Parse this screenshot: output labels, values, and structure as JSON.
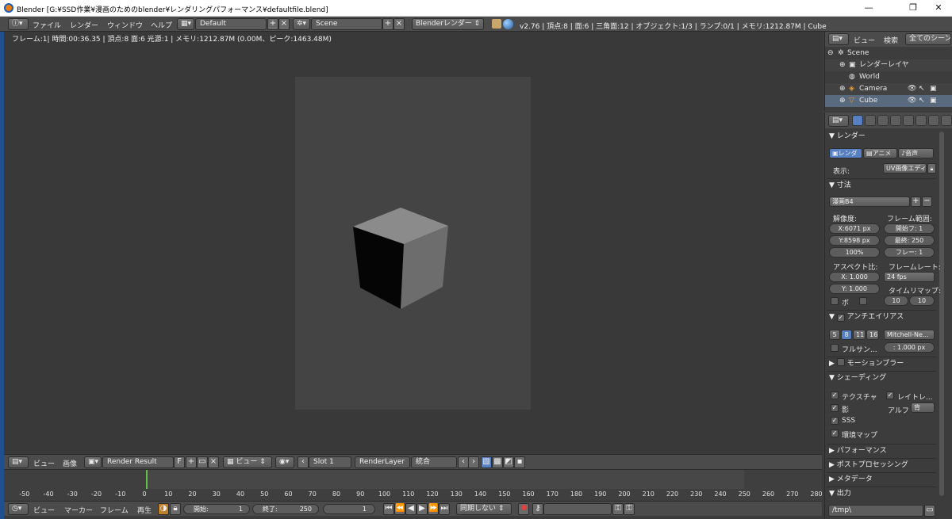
{
  "window": {
    "title": "Blender [G:¥SSD作業¥漫画のためのblender¥レンダリングパフォーマンス¥defaultfile.blend]",
    "minimize": "—",
    "maximize": "❐",
    "close": "✕"
  },
  "info_header": {
    "menus": [
      "ファイル",
      "レンダー",
      "ウィンドウ",
      "ヘルプ"
    ],
    "screen_layout": "Default",
    "scene": "Scene",
    "render_engine": "Blenderレンダー",
    "stats": "v2.76 | 頂点:8 | 面:6 | 三角面:12 | オブジェクト:1/3 | ランプ:0/1 | メモリ:1212.87M | Cube"
  },
  "image_editor": {
    "render_info": "フレーム:1| 時間:00:36.35 | 頂点:8 面:6 光源:1 | メモリ:1212.87M (0.00M、ピーク:1463.48M)"
  },
  "image_header": {
    "view_menu": "ビュー",
    "image_menu": "画像",
    "image_name": "Render Result",
    "fake_user": "F",
    "draw_mode": "ビュー",
    "slot": "Slot 1",
    "render_layer": "RenderLayer",
    "pass": "統合"
  },
  "timeline": {
    "ticks": [
      "-50",
      "-40",
      "-30",
      "-20",
      "-10",
      "0",
      "10",
      "20",
      "30",
      "40",
      "50",
      "60",
      "70",
      "80",
      "90",
      "100",
      "110",
      "120",
      "130",
      "140",
      "150",
      "160",
      "170",
      "180",
      "190",
      "200",
      "210",
      "220",
      "230",
      "240",
      "250",
      "260",
      "270",
      "280"
    ],
    "current_frame": 1,
    "frame_start": 1,
    "frame_end": 250
  },
  "timeline_header": {
    "menus": [
      "ビュー",
      "マーカー",
      "フレーム",
      "再生"
    ],
    "start_label": "開始:",
    "start_value": "1",
    "end_label": "終了:",
    "end_value": "250",
    "current_value": "1",
    "sync": "同期しない"
  },
  "outliner": {
    "header": {
      "view": "ビュー",
      "search": "検索",
      "filter": "全てのシーン"
    },
    "items": [
      {
        "label": "Scene",
        "indent": 0
      },
      {
        "label": "レンダーレイヤ",
        "indent": 1
      },
      {
        "label": "World",
        "indent": 1
      },
      {
        "label": "Camera",
        "indent": 1
      },
      {
        "label": "Cube",
        "indent": 1
      }
    ]
  },
  "properties": {
    "render_panel": {
      "title": "レンダー",
      "render_btn": "レンダ",
      "anim_btn": "アニメ",
      "audio_btn": "音声",
      "display_label": "表示:",
      "display_value": "UV画像エディ"
    },
    "dimensions_panel": {
      "title": "寸法",
      "preset": "漫画B4",
      "resolution_label": "解像度:",
      "res_x": "X:6071 px",
      "res_y": "Y:8598 px",
      "res_pct": "100%",
      "frame_range_label": "フレーム範囲:",
      "start": "開始フ:   1",
      "end": "最終:   250",
      "step": "フレー:   1",
      "aspect_label": "アスペクト比:",
      "aspect_x": "X:   1.000",
      "aspect_y": "Y:   1.000",
      "framerate_label": "フレームレート:",
      "fps": "24 fps",
      "time_remap_label": "タイムリマップ:",
      "remap_old": "10",
      "remap_new": "10",
      "border_label": "ボ"
    },
    "aa_panel": {
      "title": "アンチエイリアス",
      "samples": [
        "5",
        "8",
        "11",
        "16"
      ],
      "filter": "Mitchell-Ne...",
      "full_sample": "フルサン...",
      "filter_size": ": 1.000 px"
    },
    "motion_blur_panel": {
      "title": "モーションブラー"
    },
    "shading_panel": {
      "title": "シェーディング",
      "textures": "テクスチャ",
      "raytracing": "レイトレ...",
      "shadows": "影",
      "alpha_label": "アルフ",
      "alpha_value": "背",
      "sss": "SSS",
      "env_map": "環境マップ"
    },
    "collapsed_panels": [
      "パフォーマンス",
      "ポストプロセッシング",
      "メタデータ",
      "出力"
    ],
    "output_path": "/tmp\\"
  },
  "colors": {
    "accent": "#5680c2",
    "current_frame": "#60c040",
    "window_bg": "#393939"
  }
}
